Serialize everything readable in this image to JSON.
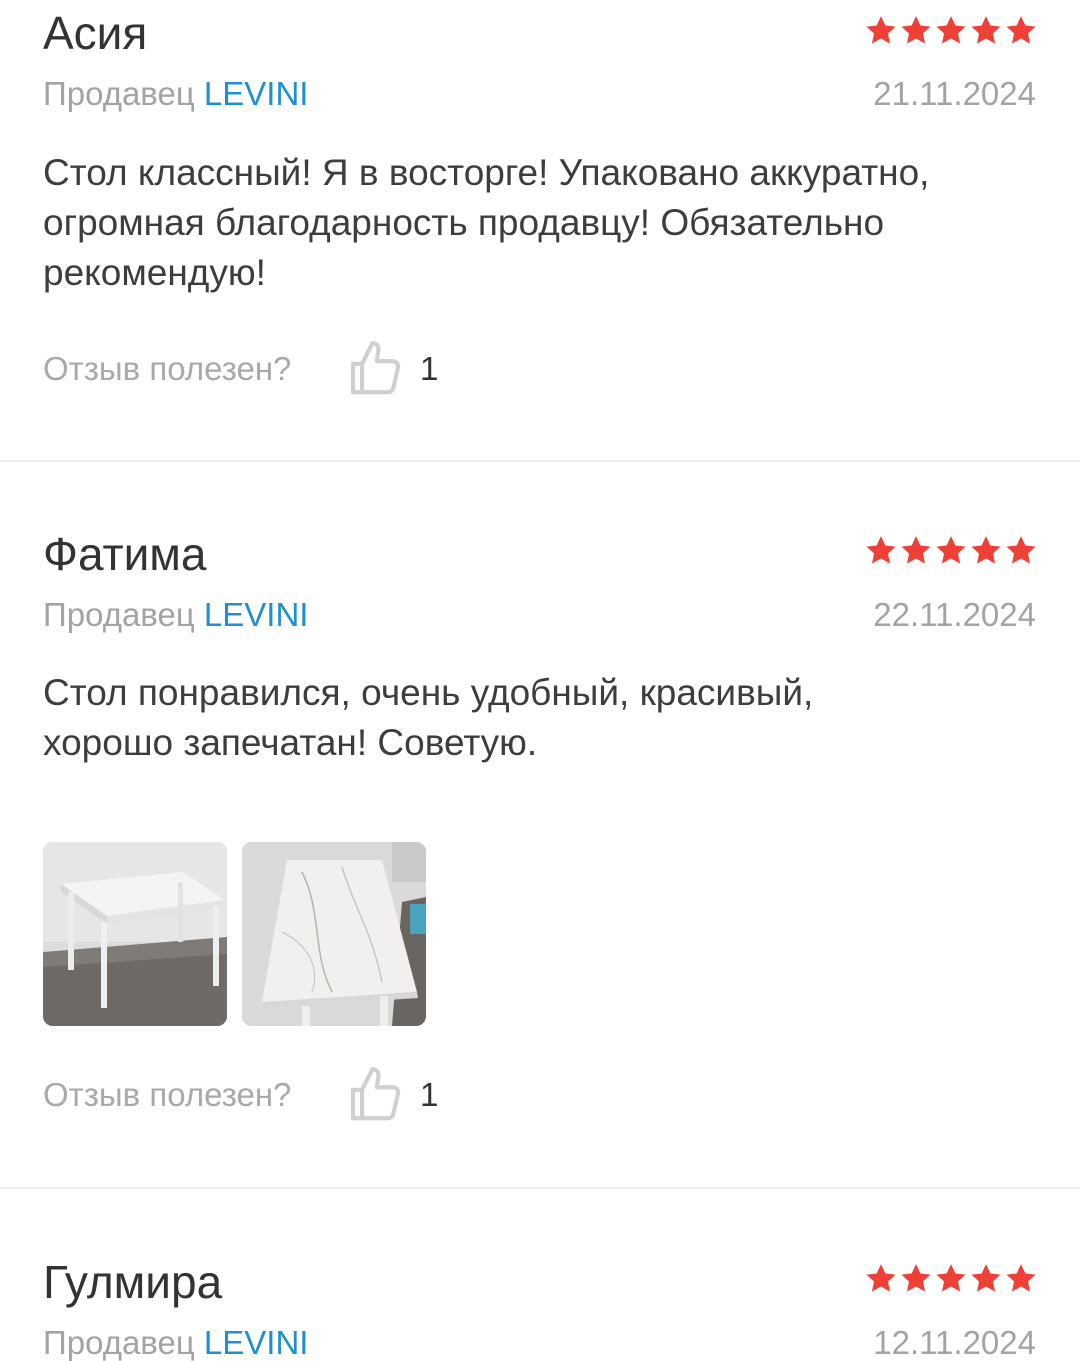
{
  "reviews": [
    {
      "name": "Асия",
      "rating": 5,
      "seller_label": "Продавец",
      "seller_name": "LEVINI",
      "date": "21.11.2024",
      "text_lines": [
        "Стол классный! Я в восторге! Упаковано аккуратно,",
        "огромная благодарность продавцу! Обязательно",
        "рекомендую!"
      ],
      "helpful_label": "Отзыв полезен?",
      "helpful_count": "1"
    },
    {
      "name": "Фатима",
      "rating": 5,
      "seller_label": "Продавец",
      "seller_name": "LEVINI",
      "date": "22.11.2024",
      "text_lines": [
        "Стол понравился, очень удобный, красивый,",
        "хорошо запечатан! Советую."
      ],
      "photos": [
        "white table photo",
        "white table top close-up photo"
      ],
      "helpful_label": "Отзыв полезен?",
      "helpful_count": "1"
    },
    {
      "name": "Гулмира",
      "rating": 5,
      "seller_label": "Продавец",
      "seller_name": "LEVINI",
      "date": "12.11.2024"
    }
  ],
  "colors": {
    "star": "#ee4036",
    "brand": "#1f8fd3",
    "muted": "#a3a3a3"
  },
  "icons": {
    "star": "star-icon",
    "helpful": "thumbs-up-icon"
  }
}
